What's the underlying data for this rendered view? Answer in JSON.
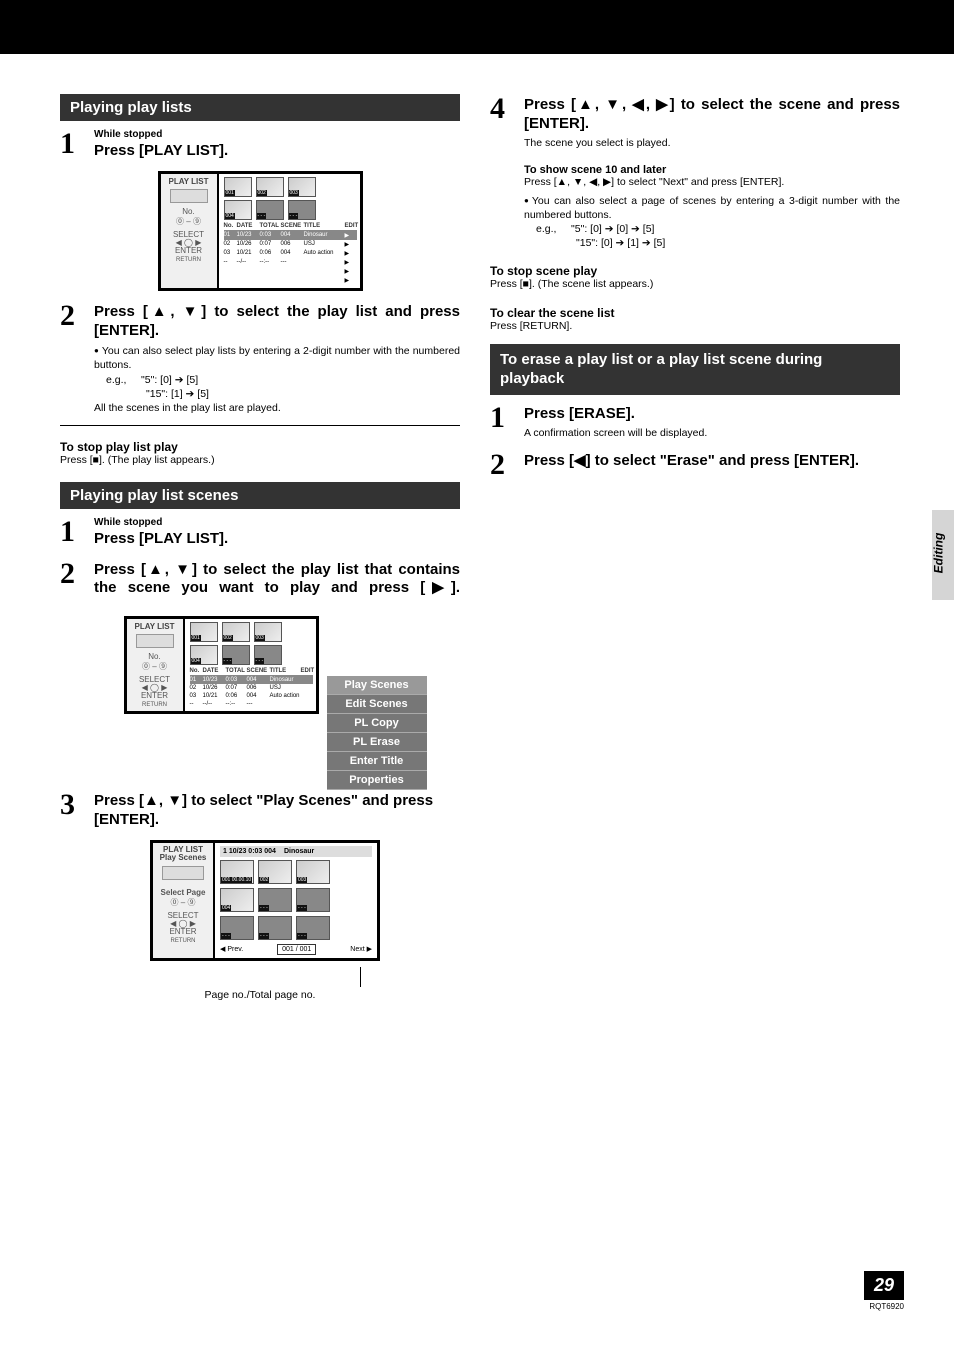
{
  "headers": {
    "playing_play_lists": "Playing play lists",
    "playing_play_list_scenes": "Playing play list scenes",
    "erase_during_playback": "To erase a play list or a play list scene during playback"
  },
  "left": {
    "step1_label": "While stopped",
    "step1_title": "Press [PLAY LIST].",
    "step2_title": "Press [▲, ▼] to select the play list and press [ENTER].",
    "step2_note1": "You can also select play lists by entering a 2-digit number with the numbered buttons.",
    "step2_eg_label": "e.g.,",
    "step2_eg_line1": "\"5\":   [0] ➔ [5]",
    "step2_eg_line2": "\"15\": [1] ➔ [5]",
    "step2_note2": "All the scenes in the play list are played.",
    "stop_head": "To stop play list play",
    "stop_body": "Press [■]. (The play list appears.)",
    "scenes_step1_label": "While stopped",
    "scenes_step1_title": "Press [PLAY LIST].",
    "scenes_step2_title": "Press [▲, ▼] to select the play list that contains the scene you want to play and press [▶].",
    "scenes_step3_title": "Press [▲, ▼] to select \"Play Scenes\" and press [ENTER].",
    "page_caption": "Page no./Total page no."
  },
  "right": {
    "step4_title": "Press [▲, ▼, ◀, ▶] to select the scene and press [ENTER].",
    "step4_body": "The scene you select is played.",
    "show10_head": "To show scene 10 and later",
    "show10_line1": "Press [▲, ▼, ◀, ▶] to select \"Next\" and press [ENTER].",
    "show10_line2": "You can also select a page of scenes by entering a 3-digit number with the numbered buttons.",
    "show10_eg_label": "e.g.,",
    "show10_eg_line1": "\"5\":   [0] ➔ [0] ➔ [5]",
    "show10_eg_line2": "\"15\": [0] ➔ [1] ➔ [5]",
    "stop_scene_head": "To stop scene play",
    "stop_scene_body": "Press [■]. (The scene list appears.)",
    "clear_head": "To clear the scene list",
    "clear_body": "Press [RETURN].",
    "erase_step1_title": "Press [ERASE].",
    "erase_step1_body": "A confirmation screen will be displayed.",
    "erase_step2_title": "Press [◀] to select \"Erase\" and press [ENTER]."
  },
  "osd_playlist": {
    "title": "PLAY LIST",
    "no_label": "No.",
    "nums": "⓪ – ⑨",
    "select": "SELECT",
    "enter": "ENTER",
    "return": "RETURN",
    "thumb_nums": [
      "001",
      "002",
      "003",
      "004",
      "- - -",
      "- - -"
    ],
    "columns": [
      "No.",
      "DATE",
      "TOTAL",
      "SCENE",
      "TITLE",
      "EDIT"
    ],
    "rows": [
      {
        "no": "01",
        "date": "10/23",
        "total": "0:03",
        "scene": "004",
        "title": "Dinosaur"
      },
      {
        "no": "02",
        "date": "10/26",
        "total": "0:07",
        "scene": "006",
        "title": "USJ"
      },
      {
        "no": "03",
        "date": "10/21",
        "total": "0:06",
        "scene": "004",
        "title": "Auto action"
      },
      {
        "no": "--",
        "date": "--/--",
        "total": "--:--",
        "scene": "---",
        "title": ""
      }
    ]
  },
  "side_menu": {
    "items": [
      "Play Scenes",
      "Edit Scenes",
      "PL Copy",
      "PL Erase",
      "Enter Title",
      "Properties"
    ]
  },
  "osd_scenes": {
    "title1": "PLAY LIST",
    "title2": "Play Scenes",
    "select_page": "Select Page",
    "nums": "⓪ – ⑨",
    "select": "SELECT",
    "enter": "ENTER",
    "return": "RETURN",
    "header_info": "1 10/23 0:03 004",
    "header_title": "Dinosaur",
    "thumb_nums": [
      "001  00.00.10",
      "002",
      "003",
      "004",
      "- - -",
      "- - -",
      "- - -",
      "- - -",
      "- - -"
    ],
    "prev": "◀ Prev.",
    "pager": "001 / 001",
    "next": "Next ▶"
  },
  "page": {
    "side_label": "Editing",
    "num": "29",
    "code": "RQT6920"
  }
}
